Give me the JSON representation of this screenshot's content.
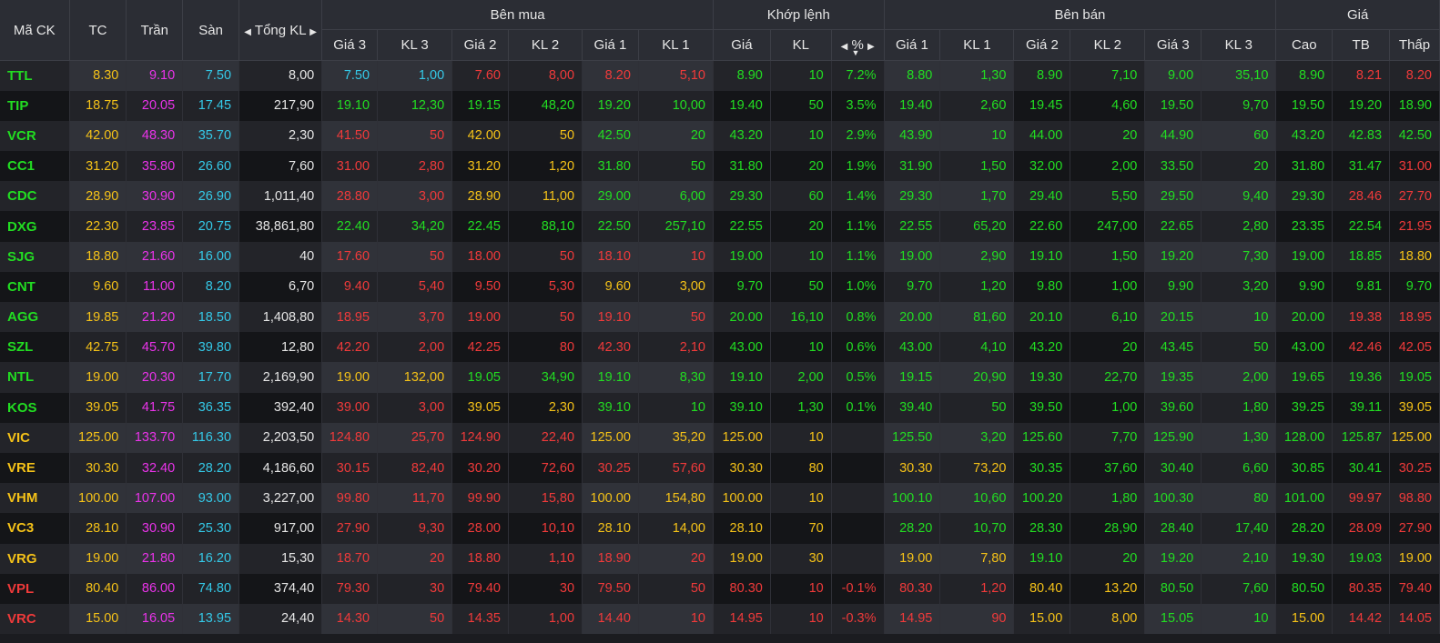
{
  "colors": {
    "up": "#22dd22",
    "down": "#f03a3a",
    "ref": "#f5c218",
    "ceil": "#ea33ea",
    "floor": "#34c9e8"
  },
  "header": {
    "symbol": "Mã CK",
    "ref": "TC",
    "ceil": "Trần",
    "floor": "Sàn",
    "total_vol": "Tổng KL",
    "buy_group": "Bên mua",
    "match_group": "Khớp lệnh",
    "sell_group": "Bên bán",
    "price_group": "Giá",
    "buy_cols": [
      "Giá 3",
      "KL 3",
      "Giá 2",
      "KL 2",
      "Giá 1",
      "KL 1"
    ],
    "match_cols": [
      "Giá",
      "KL",
      "%"
    ],
    "sell_cols": [
      "Giá 1",
      "KL 1",
      "Giá 2",
      "KL 2",
      "Giá 3",
      "KL 3"
    ],
    "price_cols": [
      "Cao",
      "TB",
      "Thấp"
    ]
  },
  "rows": [
    {
      "sym": "TTL",
      "tc": "8.30",
      "tran": "9.10",
      "san": "7.50",
      "vol": "8,00",
      "b3": "7.50",
      "kb3": "1,00",
      "b2": "7.60",
      "kb2": "8,00",
      "b1": "8.20",
      "kb1": "5,10",
      "mp": "8.90",
      "mv": "10",
      "pct": "7.2%",
      "s1": "8.80",
      "ks1": "1,30",
      "s2": "8.90",
      "ks2": "7,10",
      "s3": "9.00",
      "ks3": "35,10",
      "hi": "8.90",
      "avg": "8.21",
      "lo": "8.20",
      "c": {
        "sym": "up",
        "b3": "floor",
        "b2": "down",
        "b1": "down",
        "mp": "up",
        "pct": "up",
        "s1": "up",
        "s2": "up",
        "s3": "up",
        "hi": "up",
        "avg": "down",
        "lo": "down"
      }
    },
    {
      "sym": "TIP",
      "tc": "18.75",
      "tran": "20.05",
      "san": "17.45",
      "vol": "217,90",
      "b3": "19.10",
      "kb3": "12,30",
      "b2": "19.15",
      "kb2": "48,20",
      "b1": "19.20",
      "kb1": "10,00",
      "mp": "19.40",
      "mv": "50",
      "pct": "3.5%",
      "s1": "19.40",
      "ks1": "2,60",
      "s2": "19.45",
      "ks2": "4,60",
      "s3": "19.50",
      "ks3": "9,70",
      "hi": "19.50",
      "avg": "19.20",
      "lo": "18.90",
      "c": {
        "sym": "up",
        "b3": "up",
        "b2": "up",
        "b1": "up",
        "mp": "up",
        "pct": "up",
        "s1": "up",
        "s2": "up",
        "s3": "up",
        "hi": "up",
        "avg": "up",
        "lo": "up"
      }
    },
    {
      "sym": "VCR",
      "tc": "42.00",
      "tran": "48.30",
      "san": "35.70",
      "vol": "2,30",
      "b3": "41.50",
      "kb3": "50",
      "b2": "42.00",
      "kb2": "50",
      "b1": "42.50",
      "kb1": "20",
      "mp": "43.20",
      "mv": "10",
      "pct": "2.9%",
      "s1": "43.90",
      "ks1": "10",
      "s2": "44.00",
      "ks2": "20",
      "s3": "44.90",
      "ks3": "60",
      "hi": "43.20",
      "avg": "42.83",
      "lo": "42.50",
      "c": {
        "sym": "up",
        "b3": "down",
        "b2": "ref",
        "b1": "up",
        "mp": "up",
        "pct": "up",
        "s1": "up",
        "s2": "up",
        "s3": "up",
        "hi": "up",
        "avg": "up",
        "lo": "up"
      }
    },
    {
      "sym": "CC1",
      "tc": "31.20",
      "tran": "35.80",
      "san": "26.60",
      "vol": "7,60",
      "b3": "31.00",
      "kb3": "2,80",
      "b2": "31.20",
      "kb2": "1,20",
      "b1": "31.80",
      "kb1": "50",
      "mp": "31.80",
      "mv": "20",
      "pct": "1.9%",
      "s1": "31.90",
      "ks1": "1,50",
      "s2": "32.00",
      "ks2": "2,00",
      "s3": "33.50",
      "ks3": "20",
      "hi": "31.80",
      "avg": "31.47",
      "lo": "31.00",
      "c": {
        "sym": "up",
        "b3": "down",
        "b2": "ref",
        "b1": "up",
        "mp": "up",
        "pct": "up",
        "s1": "up",
        "s2": "up",
        "s3": "up",
        "hi": "up",
        "avg": "up",
        "lo": "down"
      }
    },
    {
      "sym": "CDC",
      "tc": "28.90",
      "tran": "30.90",
      "san": "26.90",
      "vol": "1,011,40",
      "b3": "28.80",
      "kb3": "3,00",
      "b2": "28.90",
      "kb2": "11,00",
      "b1": "29.00",
      "kb1": "6,00",
      "mp": "29.30",
      "mv": "60",
      "pct": "1.4%",
      "s1": "29.30",
      "ks1": "1,70",
      "s2": "29.40",
      "ks2": "5,50",
      "s3": "29.50",
      "ks3": "9,40",
      "hi": "29.30",
      "avg": "28.46",
      "lo": "27.70",
      "c": {
        "sym": "up",
        "b3": "down",
        "b2": "ref",
        "b1": "up",
        "mp": "up",
        "pct": "up",
        "s1": "up",
        "s2": "up",
        "s3": "up",
        "hi": "up",
        "avg": "down",
        "lo": "down"
      }
    },
    {
      "sym": "DXG",
      "tc": "22.30",
      "tran": "23.85",
      "san": "20.75",
      "vol": "38,861,80",
      "b3": "22.40",
      "kb3": "34,20",
      "b2": "22.45",
      "kb2": "88,10",
      "b1": "22.50",
      "kb1": "257,10",
      "mp": "22.55",
      "mv": "20",
      "pct": "1.1%",
      "s1": "22.55",
      "ks1": "65,20",
      "s2": "22.60",
      "ks2": "247,00",
      "s3": "22.65",
      "ks3": "2,80",
      "hi": "23.35",
      "avg": "22.54",
      "lo": "21.95",
      "c": {
        "sym": "up",
        "b3": "up",
        "b2": "up",
        "b1": "up",
        "mp": "up",
        "pct": "up",
        "s1": "up",
        "s2": "up",
        "s3": "up",
        "hi": "up",
        "avg": "up",
        "lo": "down"
      }
    },
    {
      "sym": "SJG",
      "tc": "18.80",
      "tran": "21.60",
      "san": "16.00",
      "vol": "40",
      "b3": "17.60",
      "kb3": "50",
      "b2": "18.00",
      "kb2": "50",
      "b1": "18.10",
      "kb1": "10",
      "mp": "19.00",
      "mv": "10",
      "pct": "1.1%",
      "s1": "19.00",
      "ks1": "2,90",
      "s2": "19.10",
      "ks2": "1,50",
      "s3": "19.20",
      "ks3": "7,30",
      "hi": "19.00",
      "avg": "18.85",
      "lo": "18.80",
      "c": {
        "sym": "up",
        "b3": "down",
        "b2": "down",
        "b1": "down",
        "mp": "up",
        "pct": "up",
        "s1": "up",
        "s2": "up",
        "s3": "up",
        "hi": "up",
        "avg": "up",
        "lo": "ref"
      }
    },
    {
      "sym": "CNT",
      "tc": "9.60",
      "tran": "11.00",
      "san": "8.20",
      "vol": "6,70",
      "b3": "9.40",
      "kb3": "5,40",
      "b2": "9.50",
      "kb2": "5,30",
      "b1": "9.60",
      "kb1": "3,00",
      "mp": "9.70",
      "mv": "50",
      "pct": "1.0%",
      "s1": "9.70",
      "ks1": "1,20",
      "s2": "9.80",
      "ks2": "1,00",
      "s3": "9.90",
      "ks3": "3,20",
      "hi": "9.90",
      "avg": "9.81",
      "lo": "9.70",
      "c": {
        "sym": "up",
        "b3": "down",
        "b2": "down",
        "b1": "ref",
        "mp": "up",
        "pct": "up",
        "s1": "up",
        "s2": "up",
        "s3": "up",
        "hi": "up",
        "avg": "up",
        "lo": "up"
      }
    },
    {
      "sym": "AGG",
      "tc": "19.85",
      "tran": "21.20",
      "san": "18.50",
      "vol": "1,408,80",
      "b3": "18.95",
      "kb3": "3,70",
      "b2": "19.00",
      "kb2": "50",
      "b1": "19.10",
      "kb1": "50",
      "mp": "20.00",
      "mv": "16,10",
      "pct": "0.8%",
      "s1": "20.00",
      "ks1": "81,60",
      "s2": "20.10",
      "ks2": "6,10",
      "s3": "20.15",
      "ks3": "10",
      "hi": "20.00",
      "avg": "19.38",
      "lo": "18.95",
      "c": {
        "sym": "up",
        "b3": "down",
        "b2": "down",
        "b1": "down",
        "mp": "up",
        "pct": "up",
        "s1": "up",
        "s2": "up",
        "s3": "up",
        "hi": "up",
        "avg": "down",
        "lo": "down"
      }
    },
    {
      "sym": "SZL",
      "tc": "42.75",
      "tran": "45.70",
      "san": "39.80",
      "vol": "12,80",
      "b3": "42.20",
      "kb3": "2,00",
      "b2": "42.25",
      "kb2": "80",
      "b1": "42.30",
      "kb1": "2,10",
      "mp": "43.00",
      "mv": "10",
      "pct": "0.6%",
      "s1": "43.00",
      "ks1": "4,10",
      "s2": "43.20",
      "ks2": "20",
      "s3": "43.45",
      "ks3": "50",
      "hi": "43.00",
      "avg": "42.46",
      "lo": "42.05",
      "c": {
        "sym": "up",
        "b3": "down",
        "b2": "down",
        "b1": "down",
        "mp": "up",
        "pct": "up",
        "s1": "up",
        "s2": "up",
        "s3": "up",
        "hi": "up",
        "avg": "down",
        "lo": "down"
      }
    },
    {
      "sym": "NTL",
      "tc": "19.00",
      "tran": "20.30",
      "san": "17.70",
      "vol": "2,169,90",
      "b3": "19.00",
      "kb3": "132,00",
      "b2": "19.05",
      "kb2": "34,90",
      "b1": "19.10",
      "kb1": "8,30",
      "mp": "19.10",
      "mv": "2,00",
      "pct": "0.5%",
      "s1": "19.15",
      "ks1": "20,90",
      "s2": "19.30",
      "ks2": "22,70",
      "s3": "19.35",
      "ks3": "2,00",
      "hi": "19.65",
      "avg": "19.36",
      "lo": "19.05",
      "c": {
        "sym": "up",
        "b3": "ref",
        "b2": "up",
        "b1": "up",
        "mp": "up",
        "pct": "up",
        "s1": "up",
        "s2": "up",
        "s3": "up",
        "hi": "up",
        "avg": "up",
        "lo": "up"
      }
    },
    {
      "sym": "KOS",
      "tc": "39.05",
      "tran": "41.75",
      "san": "36.35",
      "vol": "392,40",
      "b3": "39.00",
      "kb3": "3,00",
      "b2": "39.05",
      "kb2": "2,30",
      "b1": "39.10",
      "kb1": "10",
      "mp": "39.10",
      "mv": "1,30",
      "pct": "0.1%",
      "s1": "39.40",
      "ks1": "50",
      "s2": "39.50",
      "ks2": "1,00",
      "s3": "39.60",
      "ks3": "1,80",
      "hi": "39.25",
      "avg": "39.11",
      "lo": "39.05",
      "c": {
        "sym": "up",
        "b3": "down",
        "b2": "ref",
        "b1": "up",
        "mp": "up",
        "pct": "up",
        "s1": "up",
        "s2": "up",
        "s3": "up",
        "hi": "up",
        "avg": "up",
        "lo": "ref"
      }
    },
    {
      "sym": "VIC",
      "tc": "125.00",
      "tran": "133.70",
      "san": "116.30",
      "vol": "2,203,50",
      "b3": "124.80",
      "kb3": "25,70",
      "b2": "124.90",
      "kb2": "22,40",
      "b1": "125.00",
      "kb1": "35,20",
      "mp": "125.00",
      "mv": "10",
      "pct": "",
      "s1": "125.50",
      "ks1": "3,20",
      "s2": "125.60",
      "ks2": "7,70",
      "s3": "125.90",
      "ks3": "1,30",
      "hi": "128.00",
      "avg": "125.87",
      "lo": "125.00",
      "c": {
        "sym": "ref",
        "b3": "down",
        "b2": "down",
        "b1": "ref",
        "mp": "ref",
        "pct": "ref",
        "s1": "up",
        "s2": "up",
        "s3": "up",
        "hi": "up",
        "avg": "up",
        "lo": "ref"
      }
    },
    {
      "sym": "VRE",
      "tc": "30.30",
      "tran": "32.40",
      "san": "28.20",
      "vol": "4,186,60",
      "b3": "30.15",
      "kb3": "82,40",
      "b2": "30.20",
      "kb2": "72,60",
      "b1": "30.25",
      "kb1": "57,60",
      "mp": "30.30",
      "mv": "80",
      "pct": "",
      "s1": "30.30",
      "ks1": "73,20",
      "s2": "30.35",
      "ks2": "37,60",
      "s3": "30.40",
      "ks3": "6,60",
      "hi": "30.85",
      "avg": "30.41",
      "lo": "30.25",
      "c": {
        "sym": "ref",
        "b3": "down",
        "b2": "down",
        "b1": "down",
        "mp": "ref",
        "pct": "ref",
        "s1": "ref",
        "s2": "up",
        "s3": "up",
        "hi": "up",
        "avg": "up",
        "lo": "down"
      }
    },
    {
      "sym": "VHM",
      "tc": "100.00",
      "tran": "107.00",
      "san": "93.00",
      "vol": "3,227,00",
      "b3": "99.80",
      "kb3": "11,70",
      "b2": "99.90",
      "kb2": "15,80",
      "b1": "100.00",
      "kb1": "154,80",
      "mp": "100.00",
      "mv": "10",
      "pct": "",
      "s1": "100.10",
      "ks1": "10,60",
      "s2": "100.20",
      "ks2": "1,80",
      "s3": "100.30",
      "ks3": "80",
      "hi": "101.00",
      "avg": "99.97",
      "lo": "98.80",
      "c": {
        "sym": "ref",
        "b3": "down",
        "b2": "down",
        "b1": "ref",
        "mp": "ref",
        "pct": "ref",
        "s1": "up",
        "s2": "up",
        "s3": "up",
        "hi": "up",
        "avg": "down",
        "lo": "down"
      }
    },
    {
      "sym": "VC3",
      "tc": "28.10",
      "tran": "30.90",
      "san": "25.30",
      "vol": "917,00",
      "b3": "27.90",
      "kb3": "9,30",
      "b2": "28.00",
      "kb2": "10,10",
      "b1": "28.10",
      "kb1": "14,00",
      "mp": "28.10",
      "mv": "70",
      "pct": "",
      "s1": "28.20",
      "ks1": "10,70",
      "s2": "28.30",
      "ks2": "28,90",
      "s3": "28.40",
      "ks3": "17,40",
      "hi": "28.20",
      "avg": "28.09",
      "lo": "27.90",
      "c": {
        "sym": "ref",
        "b3": "down",
        "b2": "down",
        "b1": "ref",
        "mp": "ref",
        "pct": "ref",
        "s1": "up",
        "s2": "up",
        "s3": "up",
        "hi": "up",
        "avg": "down",
        "lo": "down"
      }
    },
    {
      "sym": "VRG",
      "tc": "19.00",
      "tran": "21.80",
      "san": "16.20",
      "vol": "15,30",
      "b3": "18.70",
      "kb3": "20",
      "b2": "18.80",
      "kb2": "1,10",
      "b1": "18.90",
      "kb1": "20",
      "mp": "19.00",
      "mv": "30",
      "pct": "",
      "s1": "19.00",
      "ks1": "7,80",
      "s2": "19.10",
      "ks2": "20",
      "s3": "19.20",
      "ks3": "2,10",
      "hi": "19.30",
      "avg": "19.03",
      "lo": "19.00",
      "c": {
        "sym": "ref",
        "b3": "down",
        "b2": "down",
        "b1": "down",
        "mp": "ref",
        "pct": "ref",
        "s1": "ref",
        "s2": "up",
        "s3": "up",
        "hi": "up",
        "avg": "up",
        "lo": "ref"
      }
    },
    {
      "sym": "VPL",
      "tc": "80.40",
      "tran": "86.00",
      "san": "74.80",
      "vol": "374,40",
      "b3": "79.30",
      "kb3": "30",
      "b2": "79.40",
      "kb2": "30",
      "b1": "79.50",
      "kb1": "50",
      "mp": "80.30",
      "mv": "10",
      "pct": "-0.1%",
      "s1": "80.30",
      "ks1": "1,20",
      "s2": "80.40",
      "ks2": "13,20",
      "s3": "80.50",
      "ks3": "7,60",
      "hi": "80.50",
      "avg": "80.35",
      "lo": "79.40",
      "c": {
        "sym": "down",
        "b3": "down",
        "b2": "down",
        "b1": "down",
        "mp": "down",
        "pct": "down",
        "s1": "down",
        "s2": "ref",
        "s3": "up",
        "hi": "up",
        "avg": "down",
        "lo": "down"
      }
    },
    {
      "sym": "VRC",
      "tc": "15.00",
      "tran": "16.05",
      "san": "13.95",
      "vol": "24,40",
      "b3": "14.30",
      "kb3": "50",
      "b2": "14.35",
      "kb2": "1,00",
      "b1": "14.40",
      "kb1": "10",
      "mp": "14.95",
      "mv": "10",
      "pct": "-0.3%",
      "s1": "14.95",
      "ks1": "90",
      "s2": "15.00",
      "ks2": "8,00",
      "s3": "15.05",
      "ks3": "10",
      "hi": "15.00",
      "avg": "14.42",
      "lo": "14.05",
      "c": {
        "sym": "down",
        "b3": "down",
        "b2": "down",
        "b1": "down",
        "mp": "down",
        "pct": "down",
        "s1": "down",
        "s2": "ref",
        "s3": "up",
        "hi": "ref",
        "avg": "down",
        "lo": "down"
      }
    }
  ]
}
